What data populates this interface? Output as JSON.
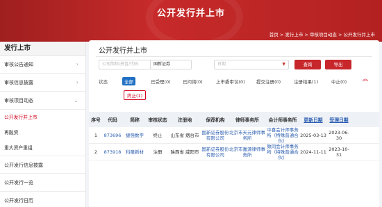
{
  "banner": {
    "title": "公开发行并上市",
    "breadcrumb": "首页 > 发行上市 > 审核项目动态 > 公开发行并上市"
  },
  "sidebar": {
    "heading": "发行上市",
    "items": [
      {
        "label": "审核公告通知",
        "chev": "›"
      },
      {
        "label": "审核信息披露",
        "chev": "›"
      },
      {
        "label": "审核项目动态",
        "chev": "⌄"
      }
    ],
    "subitems": [
      "公开发行并上市",
      "再融资",
      "重大资产重组"
    ],
    "more": [
      "公开发行信息披露",
      "公开发行一览",
      "公开发行日历"
    ]
  },
  "main": {
    "title": "公开发行并上市",
    "search_placeholder": "公司简称/拼音/代码",
    "sponsor_value": "国新证券",
    "date_placeholder": "日期",
    "query_label": "查询",
    "export_label": "导出",
    "status_label": "状态",
    "statuses": [
      "全部",
      "已受理(0)",
      "已问询(0)",
      "上市委审议(0)",
      "提交注册(0)",
      "注册结果(1)",
      "中止(0)"
    ],
    "terminated": "终止(1)",
    "collapse_icon": "︽"
  },
  "table": {
    "columns": [
      "序号",
      "代码",
      "简称",
      "审核状态",
      "注册地",
      "保荐机构",
      "律师事务所",
      "会计师事务所",
      "更新日期",
      "受理日期"
    ],
    "rows": [
      {
        "no": "1",
        "code": "873696",
        "name": "捷强数字",
        "status": "终止",
        "region": "山东省 烟台市",
        "sponsor": "国新证券股份有限公司",
        "law": "北京市天元律师事务所",
        "accountant": "中喜会计师事务所（特殊普通合伙）",
        "updated": "2025-03-13",
        "accepted": "2023-06-30"
      },
      {
        "no": "2",
        "code": "873918",
        "name": "科隆新材",
        "status": "注册",
        "region": "陕西省 咸阳市",
        "sponsor": "国新证券股份有限公司",
        "law": "北京市嘉源律师事务所",
        "accountant": "致同会计师事务所（特殊普通合伙）",
        "updated": "2024-11-11",
        "accepted": "2023-10-31"
      }
    ]
  }
}
